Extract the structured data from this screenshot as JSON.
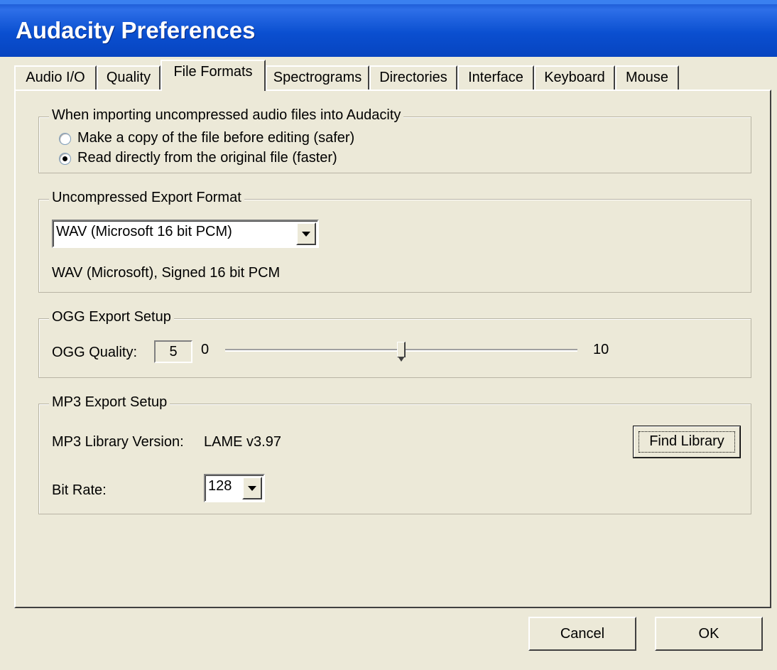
{
  "window": {
    "title": "Audacity Preferences"
  },
  "tabs": [
    {
      "label": "Audio I/O"
    },
    {
      "label": "Quality"
    },
    {
      "label": "File Formats",
      "active": true
    },
    {
      "label": "Spectrograms"
    },
    {
      "label": "Directories"
    },
    {
      "label": "Interface"
    },
    {
      "label": "Keyboard"
    },
    {
      "label": "Mouse"
    }
  ],
  "import_group": {
    "label": "When importing uncompressed audio files into Audacity",
    "options": [
      {
        "label": "Make a copy of the file before editing (safer)",
        "checked": false
      },
      {
        "label": "Read directly from the original file (faster)",
        "checked": true
      }
    ]
  },
  "export_group": {
    "label": "Uncompressed Export Format",
    "selected": "WAV (Microsoft 16 bit PCM)",
    "description": "WAV (Microsoft), Signed 16 bit PCM"
  },
  "ogg_group": {
    "label": "OGG Export Setup",
    "quality_label": "OGG Quality:",
    "quality_value": "5",
    "min_label": "0",
    "max_label": "10",
    "min": 0,
    "max": 10,
    "value": 5
  },
  "mp3_group": {
    "label": "MP3 Export Setup",
    "version_label": "MP3 Library Version:",
    "version_value": "LAME v3.97",
    "find_library_label": "Find Library",
    "bitrate_label": "Bit Rate:",
    "bitrate_value": "128"
  },
  "buttons": {
    "cancel": "Cancel",
    "ok": "OK"
  }
}
